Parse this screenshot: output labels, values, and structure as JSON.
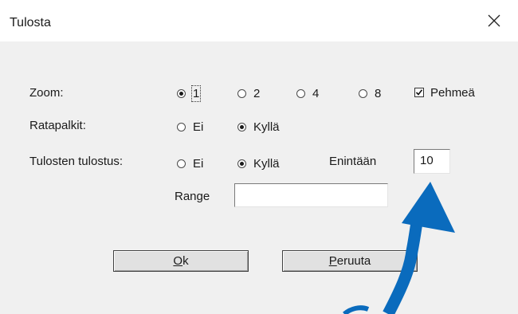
{
  "window": {
    "title": "Tulosta"
  },
  "zoom": {
    "label": "Zoom:",
    "options": [
      "1",
      "2",
      "4",
      "8"
    ],
    "selected": "1",
    "smooth_label": "Pehmeä",
    "smooth_checked": true
  },
  "scrollbars": {
    "label": "Ratapalkit:",
    "options": [
      "Ei",
      "Kyllä"
    ],
    "selected": "Kyllä"
  },
  "results": {
    "label": "Tulosten tulostus:",
    "options": [
      "Ei",
      "Kyllä"
    ],
    "selected": "Kyllä",
    "max_label": "Enintään",
    "max_value": "10"
  },
  "range": {
    "label": "Range",
    "value": ""
  },
  "buttons": {
    "ok": {
      "accel": "O",
      "rest": "k"
    },
    "cancel": {
      "accel": "P",
      "rest": "eruuta"
    }
  },
  "colors": {
    "annotation_arrow": "#0a6bbd"
  }
}
